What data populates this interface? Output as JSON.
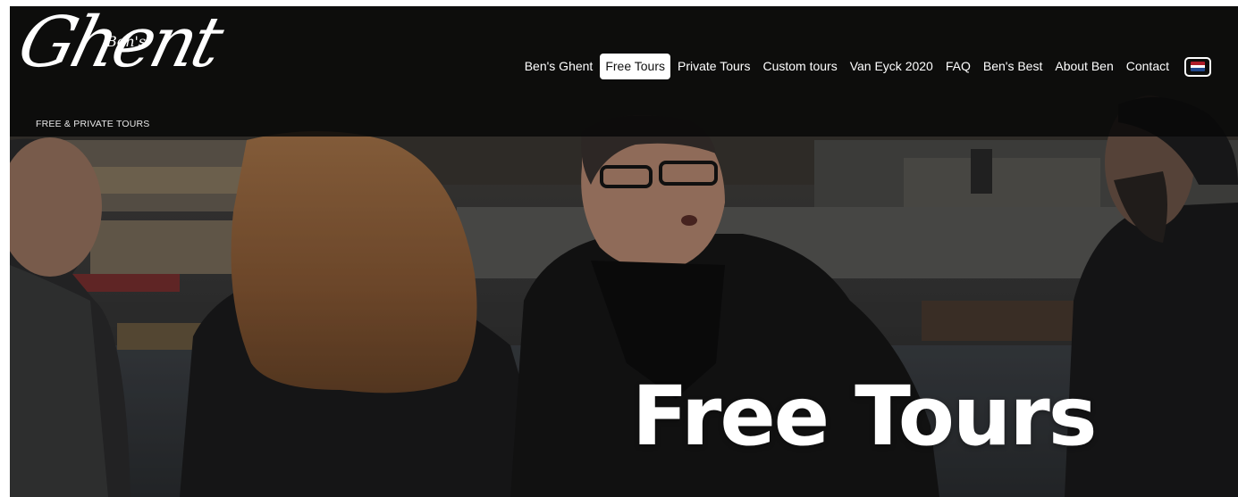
{
  "logo": {
    "script_main": "Ghent",
    "script_small": "Ben's",
    "tagline": "FREE & PRIVATE TOURS"
  },
  "nav": {
    "items": [
      {
        "label": "Ben's Ghent",
        "active": false
      },
      {
        "label": "Free Tours",
        "active": true
      },
      {
        "label": "Private Tours",
        "active": false
      },
      {
        "label": "Custom tours",
        "active": false
      },
      {
        "label": "Van Eyck 2020",
        "active": false
      },
      {
        "label": "FAQ",
        "active": false
      },
      {
        "label": "Ben's Best",
        "active": false
      },
      {
        "label": "About Ben",
        "active": false
      },
      {
        "label": "Contact",
        "active": false
      }
    ],
    "language_icon": "netherlands-flag-icon",
    "flag_colors": [
      "#AE1C28",
      "#FFFFFF",
      "#21468B"
    ]
  },
  "hero": {
    "title": "Free Tours"
  },
  "colors": {
    "header_bg": "#080808",
    "active_nav_bg": "#FFFFFF",
    "text": "#FFFFFF"
  }
}
